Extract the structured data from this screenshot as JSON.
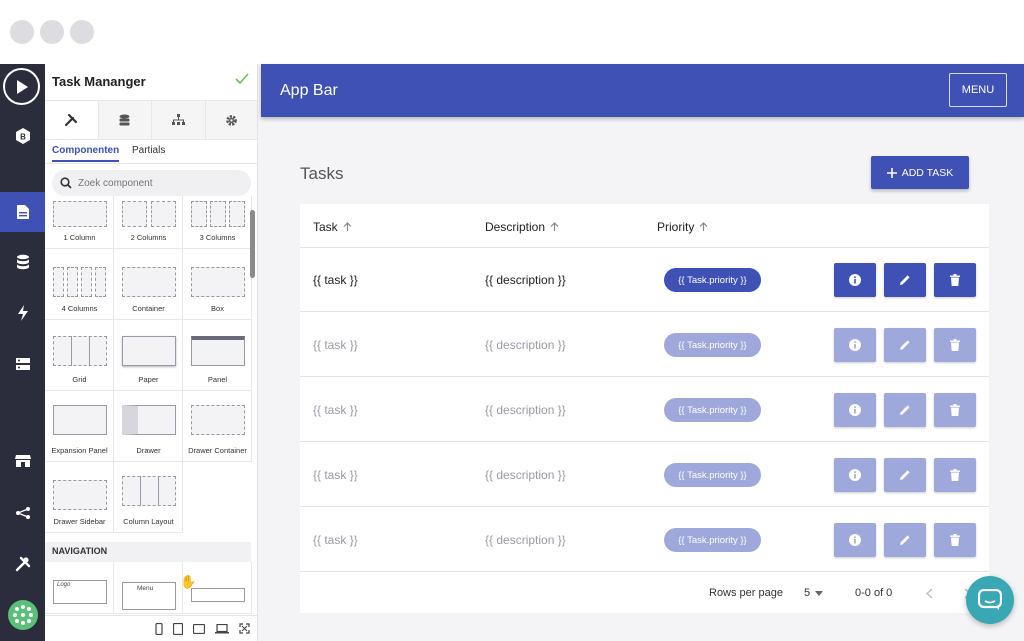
{
  "window": {
    "controls": [
      "close",
      "minimize",
      "maximize"
    ]
  },
  "rail": {
    "items": [
      {
        "icon": "play-icon"
      },
      {
        "icon": "badge-b-icon"
      },
      {
        "icon": "page-icon",
        "active": true
      },
      {
        "icon": "database-icon"
      },
      {
        "icon": "bolt-icon"
      },
      {
        "icon": "server-icon"
      },
      {
        "icon": "store-icon"
      },
      {
        "icon": "share-icon"
      },
      {
        "icon": "tools-icon"
      },
      {
        "icon": "avatar-icon"
      }
    ]
  },
  "panel": {
    "title": "Task Mananger",
    "tabs": [
      "components-tab",
      "data-tab",
      "tree-tab",
      "settings-tab"
    ],
    "subtabs": [
      "Componenten",
      "Partials"
    ],
    "search_placeholder": "Zoek component",
    "components": [
      "1 Column",
      "2 Columns",
      "3 Columns",
      "4 Columns",
      "Container",
      "Box",
      "Grid",
      "Paper",
      "Panel",
      "Expansion Panel",
      "Drawer",
      "Drawer Container",
      "Drawer Sidebar",
      "Column Layout"
    ],
    "section": "NAVIGATION",
    "nav_components": [
      {
        "logo_text": "Logo"
      },
      {
        "menu_text": "Menu"
      },
      {}
    ]
  },
  "appbar": {
    "title": "App Bar",
    "menu_label": "MENU"
  },
  "page": {
    "title": "Tasks",
    "add_label": "ADD TASK"
  },
  "table": {
    "columns": [
      "Task",
      "Description",
      "Priority"
    ],
    "rows": [
      {
        "task": "{{ task }}",
        "description": "{{ description }}",
        "priority": "{{ Task.priority }}",
        "active": true
      },
      {
        "task": "{{ task }}",
        "description": "{{ description }}",
        "priority": "{{ Task.priority }}",
        "active": false
      },
      {
        "task": "{{ task }}",
        "description": "{{ description }}",
        "priority": "{{ Task.priority }}",
        "active": false
      },
      {
        "task": "{{ task }}",
        "description": "{{ description }}",
        "priority": "{{ Task.priority }}",
        "active": false
      },
      {
        "task": "{{ task }}",
        "description": "{{ description }}",
        "priority": "{{ Task.priority }}",
        "active": false
      }
    ],
    "footer": {
      "rows_per_page_label": "Rows per page",
      "rows_per_page": "5",
      "range": "0-0 of 0"
    }
  },
  "colors": {
    "primary": "#3f51b5",
    "primary_muted": "#9fa8da",
    "rail": "#2b2d3c",
    "chat": "#3aa8b4"
  }
}
